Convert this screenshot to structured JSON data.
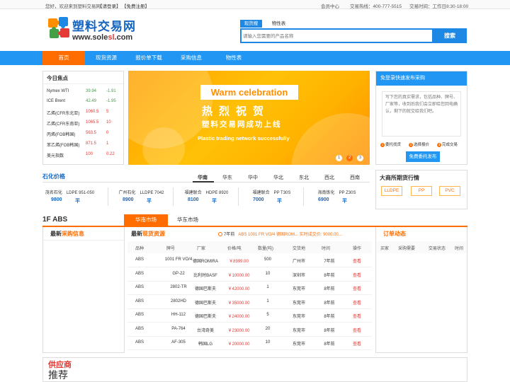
{
  "topbar": {
    "welcome": "您好，欢迎来到塑料交易网",
    "login": "【请登录】",
    "register": "【免费注册】",
    "member": "会员中心",
    "hotline": "交易热线：400-777-5515",
    "hours": "交易时间：工作日8:30-18:00"
  },
  "logo": {
    "cn": "塑料交易网",
    "en_a": "www.sole",
    "en_b": "sl",
    "en_c": ".com"
  },
  "search": {
    "tabs": [
      "现货搜",
      "物性表"
    ],
    "placeholder": "请输入您需要的产品名称",
    "button": "搜索"
  },
  "nav": [
    "首页",
    "现货资源",
    "报价单下载",
    "采购信息",
    "物性表"
  ],
  "focus": {
    "title": "今日焦点",
    "rows": [
      {
        "name": "Nymex WTI",
        "price": "39.94",
        "change": "-1.91"
      },
      {
        "name": "ICE Brent",
        "price": "42.49",
        "change": "-1.95"
      },
      {
        "name": "乙烯(CFR东北亚)",
        "price": "1060.5",
        "change": "5"
      },
      {
        "name": "乙烯(CFR东南亚)",
        "price": "1065.5",
        "change": "10"
      },
      {
        "name": "丙烯(FOB韩国)",
        "price": "563.5",
        "change": "0"
      },
      {
        "name": "苯乙烯(FOB韩国)",
        "price": "871.5",
        "change": "1"
      },
      {
        "name": "美元指数",
        "price": "100",
        "change": "0.22"
      }
    ]
  },
  "banner": {
    "warm": "Warm celebration",
    "cn1": "热烈祝贺",
    "cn2": "塑料交易网成功上线",
    "en": "Plastic trading network successfully",
    "dots": [
      "1",
      "2",
      "3"
    ],
    "active_dot": 2
  },
  "release": {
    "title": "免登录快速发布采购",
    "text": "写下您的真实需求，包括品种、牌号、厂家等，收到后我们会立即给您回电确认，剩下的就交给我们吧。",
    "steps": [
      {
        "n": "1",
        "label": "委托找货"
      },
      {
        "n": "2",
        "label": "选择报价"
      },
      {
        "n": "3",
        "label": "完成交易"
      }
    ],
    "button": "免费委托发布"
  },
  "petro": {
    "title": "石化价格",
    "tabs": [
      "华南",
      "华东",
      "华中",
      "华北",
      "东北",
      "西北",
      "西南"
    ],
    "active_tab": 0,
    "cells": [
      {
        "name": "茂名石化　LDPE 951-050",
        "price": "9800",
        "flag": "平"
      },
      {
        "name": "广州石化　LLDPE 7042",
        "price": "8900",
        "flag": "平"
      },
      {
        "name": "福建联合　HDPE 8920",
        "price": "8100",
        "flag": "平"
      },
      {
        "name": "福建联合　PP T30S",
        "price": "7000",
        "flag": "平"
      },
      {
        "name": "海南炼化　PP Z30S",
        "price": "6900",
        "flag": "平"
      }
    ]
  },
  "futures": {
    "title": "大商所期货行情",
    "items": [
      "LLDPE",
      "PP",
      "PVC"
    ]
  },
  "floor": {
    "title": "1F ABS",
    "tabs": [
      "华南市场",
      "华东市场"
    ],
    "active_tab": 0
  },
  "purchase": {
    "title_a": "最新",
    "title_b": "采购信息"
  },
  "stock": {
    "title_a": "最新",
    "title_b": "现货资源",
    "ticker_time": "7年前",
    "ticker_text": "ABS  1001 FR VO/4  德国ROM...  实时成交价: ",
    "ticker_price": "9000.00...",
    "headers": [
      "品种",
      "牌号",
      "厂家",
      "价格/吨",
      "数量(吨)",
      "交货地",
      "时间",
      "操作"
    ],
    "rows": [
      [
        "ABS",
        "1001 FR VO/4",
        "德国ROMIRA",
        "￥8999.00",
        "500",
        "广州市",
        "7年前",
        "查看"
      ],
      [
        "ABS",
        "GP-22",
        "比利时BASF",
        "￥10000.00",
        "10",
        "深圳市",
        "8年前",
        "查看"
      ],
      [
        "ABS",
        "2802-TR",
        "德国巴斯夫",
        "￥42000.00",
        "1",
        "东莞市",
        "8年前",
        "查看"
      ],
      [
        "ABS",
        "2802HD",
        "德国巴斯夫",
        "￥35000.00",
        "1",
        "东莞市",
        "8年前",
        "查看"
      ],
      [
        "ABS",
        "HH-112",
        "德国巴斯夫",
        "￥24000.00",
        "5",
        "东莞市",
        "8年前",
        "查看"
      ],
      [
        "ABS",
        "PA-764",
        "台湾奇美",
        "￥23000.00",
        "20",
        "东莞市",
        "8年前",
        "查看"
      ],
      [
        "ABS",
        "AF-305",
        "韩国LG",
        "￥20000.00",
        "10",
        "东莞市",
        "8年前",
        "查看"
      ]
    ]
  },
  "orders": {
    "title": "订单动态",
    "headers": [
      "买家",
      "采购需要",
      "交易状态",
      "时间"
    ]
  },
  "supplier": {
    "t1": "供应商",
    "t2": "推荐"
  },
  "colors": {
    "primary": "#2196f3",
    "accent": "#ff6d00",
    "price": "#e53935"
  }
}
